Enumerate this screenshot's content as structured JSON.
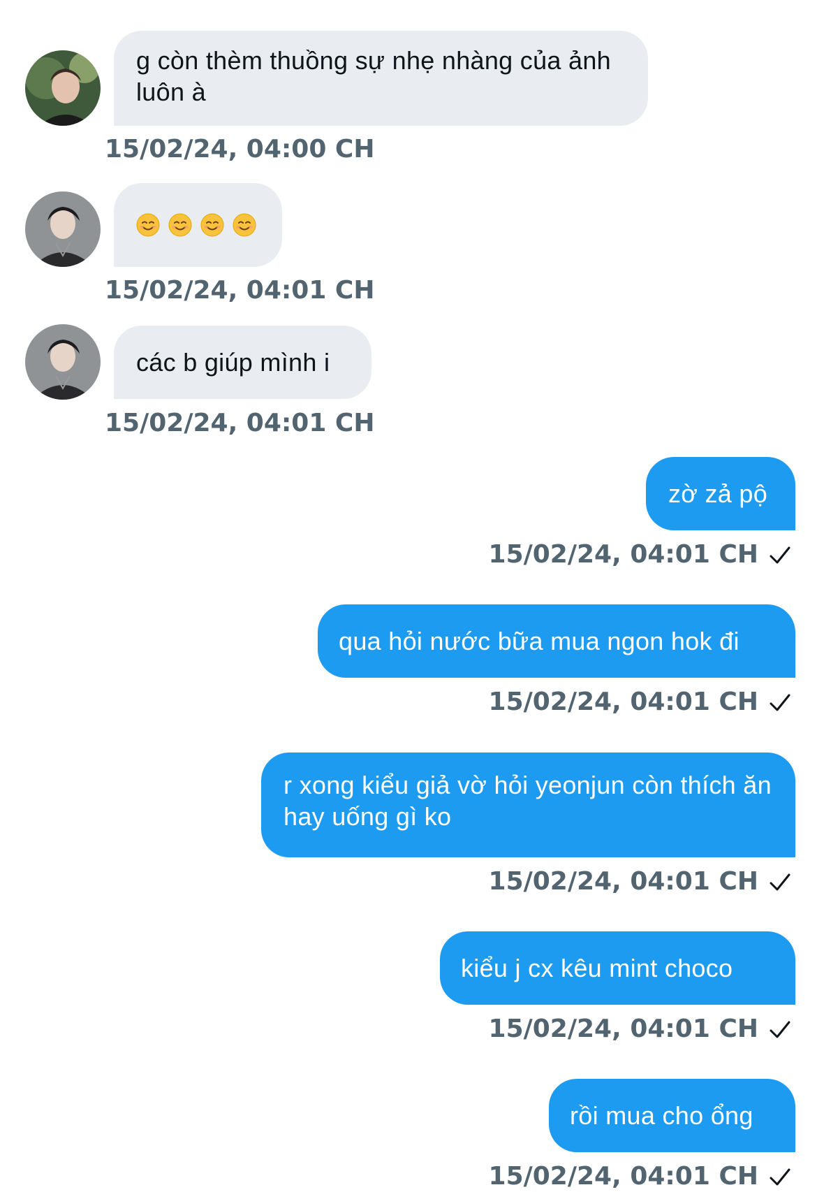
{
  "conversation": {
    "messages": [
      {
        "direction": "incoming",
        "text": "g còn thèm thuồng sự nhẹ nhàng của ảnh luôn à",
        "timestamp": "15/02/24, 04:00 CH"
      },
      {
        "direction": "incoming",
        "emoji": [
          "smiling-face-emoji",
          "smiling-face-emoji",
          "smiling-face-emoji",
          "smiling-face-emoji"
        ],
        "timestamp": "15/02/24, 04:01 CH"
      },
      {
        "direction": "incoming",
        "text": "các b giúp mình i",
        "timestamp": "15/02/24, 04:01 CH"
      },
      {
        "direction": "outgoing",
        "text": "zờ zả pộ",
        "timestamp": "15/02/24, 04:01 CH"
      },
      {
        "direction": "outgoing",
        "text": "qua hỏi nước bữa mua ngon hok đi",
        "timestamp": "15/02/24, 04:01 CH"
      },
      {
        "direction": "outgoing",
        "text": "r xong kiểu giả vờ hỏi yeonjun còn thích ăn hay uống gì ko",
        "timestamp": "15/02/24, 04:01 CH"
      },
      {
        "direction": "outgoing",
        "text": "kiểu j cx kêu mint choco",
        "timestamp": "15/02/24, 04:01 CH"
      },
      {
        "direction": "outgoing",
        "text": "rồi mua cho ổng",
        "timestamp": "15/02/24, 04:01 CH"
      }
    ]
  },
  "colors": {
    "incoming_bubble": "#e9edf1",
    "outgoing_bubble": "#1d9bf0",
    "timestamp_text": "#536471",
    "incoming_text": "#0f1419"
  },
  "icons": {
    "sent_status": "checkmark-icon"
  }
}
